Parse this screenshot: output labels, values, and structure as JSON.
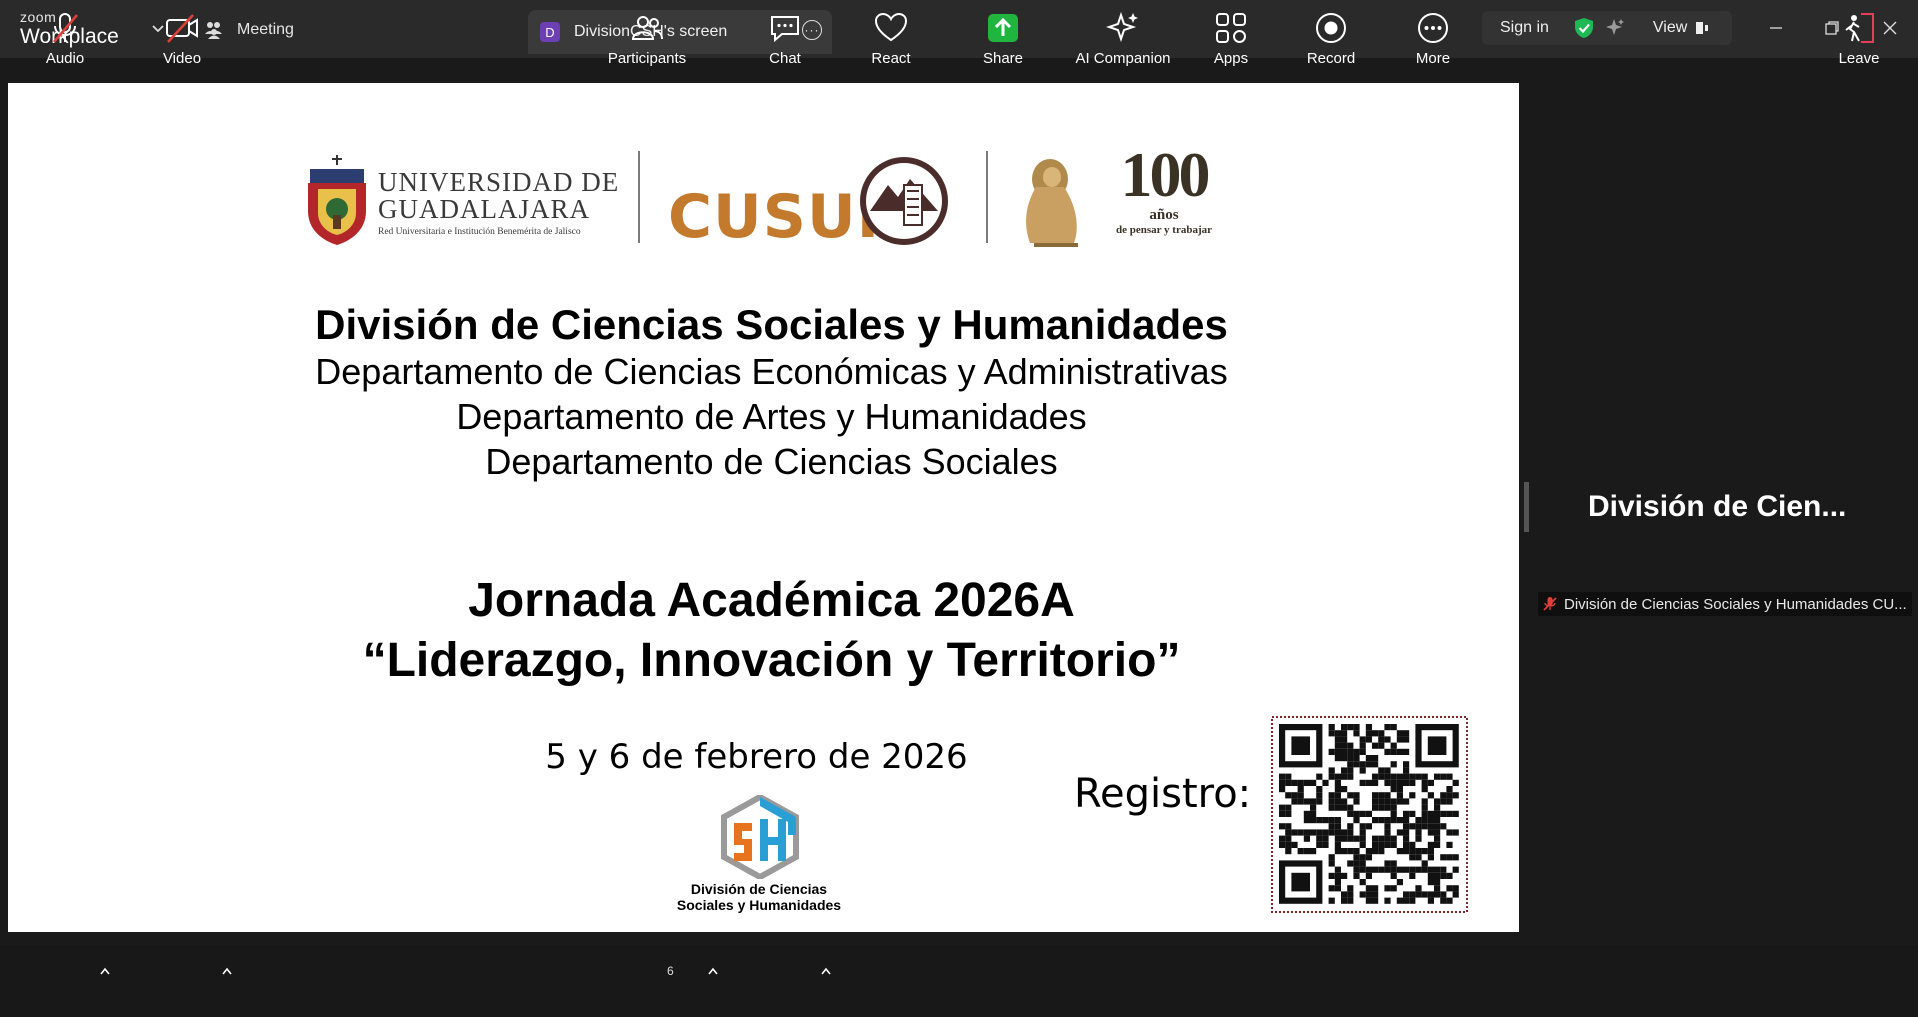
{
  "window": {
    "brand_small": "zoom",
    "brand_large": "Workplace",
    "meeting_tab": "Meeting",
    "screen_tab": "DivisionCSH's screen",
    "screen_tab_avatar": "D",
    "sign_in": "Sign in",
    "view": "View"
  },
  "slide": {
    "udg_line1": "UNIVERSIDAD DE",
    "udg_line2": "GUADALAJARA",
    "udg_line3": "Red Universitaria e Institución Benemérita de Jalisco",
    "cusur": "CUSUR",
    "centenary_number": "100",
    "centenary_word": "años",
    "centenary_tagline": "de pensar y trabajar",
    "division": "División de Ciencias Sociales y Humanidades",
    "dept1": "Departamento de Ciencias Económicas y Administrativas",
    "dept2": "Departamento de Artes y Humanidades",
    "dept3": "Departamento de Ciencias Sociales",
    "jornada": "Jornada Académica 2026A",
    "lema": "“Liderazgo, Innovación y Territorio”",
    "fecha": "5 y 6 de febrero de 2026",
    "registro": "Registro:",
    "csh_caption_1": "División de Ciencias",
    "csh_caption_2": "Sociales y Humanidades"
  },
  "panel": {
    "title": "División de Cien...",
    "participant_name": "División de Ciencias Sociales y Humanidades CU..."
  },
  "toolbar": {
    "audio": "Audio",
    "video": "Video",
    "participants": "Participants",
    "participants_count": "6",
    "chat": "Chat",
    "react": "React",
    "share": "Share",
    "ai_companion": "AI Companion",
    "apps": "Apps",
    "record": "Record",
    "more": "More",
    "leave": "Leave"
  },
  "colors": {
    "share_green": "#1fb53f",
    "muted_red": "#e0403a",
    "cusur_orange": "#c47a2c",
    "shield_green": "#1db954"
  }
}
